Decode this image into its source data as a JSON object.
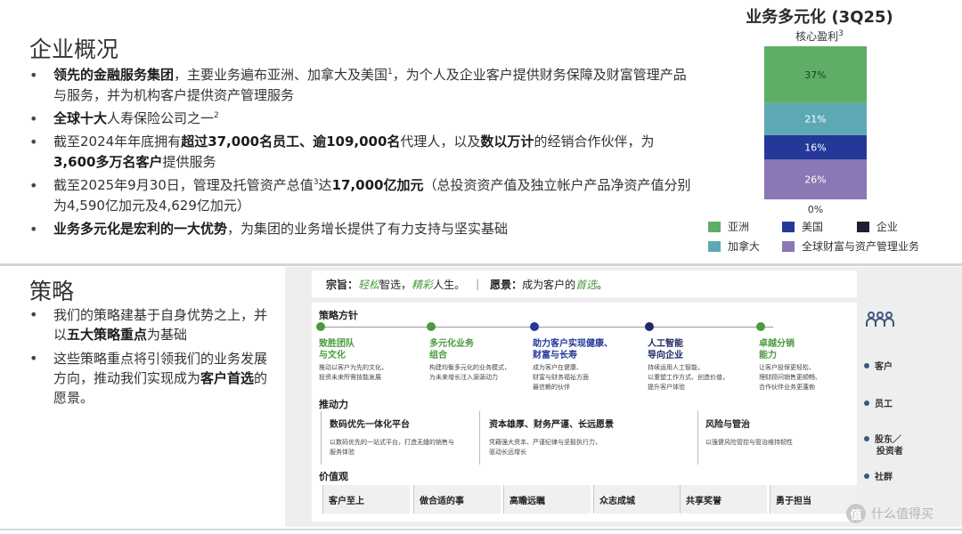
{
  "overview": {
    "title": "企业概况",
    "bullets": [
      [
        {
          "t": "领先的金融服务集团",
          "b": true
        },
        {
          "t": "，主要业务遍布亚洲、加拿大及美国",
          "b": false
        },
        {
          "t": "1",
          "sup": true
        },
        {
          "t": "，为个人及企业客户提供财务保障及财富管理产品与服务，并为机构客户提供资产管理服务",
          "b": false
        }
      ],
      [
        {
          "t": "全球十大",
          "b": true
        },
        {
          "t": "人寿保险公司之一",
          "b": false
        },
        {
          "t": "2",
          "sup": true
        }
      ],
      [
        {
          "t": "截至2024年年底拥有",
          "b": false
        },
        {
          "t": "超过37,000名员工、逾109,000名",
          "b": true
        },
        {
          "t": "代理人，以及",
          "b": false
        },
        {
          "t": "数以万计",
          "b": true
        },
        {
          "t": "的经销合作伙伴，为",
          "b": false
        },
        {
          "t": "3,600多万名客户",
          "b": true
        },
        {
          "t": "提供服务",
          "b": false
        }
      ],
      [
        {
          "t": "截至2025年9月30日，管理及托管资产总值",
          "b": false
        },
        {
          "t": "3",
          "sup": true
        },
        {
          "t": "达",
          "b": false
        },
        {
          "t": "17,000亿加元",
          "b": true
        },
        {
          "t": "（总投资资产值及独立帐户产品净资产值分别为4,590亿加元及4,629亿加元）",
          "b": false
        }
      ],
      [
        {
          "t": "业务多元化是宏利的一大优势",
          "b": true
        },
        {
          "t": "，为集团的业务增长提供了有力支持与坚实基础",
          "b": false
        }
      ]
    ]
  },
  "chart_data": {
    "type": "bar",
    "title": "业务多元化 (3Q25)",
    "subtitle": "核心盈利",
    "subtitle_sup": "3",
    "stacked": true,
    "series": [
      {
        "name": "全球财富与资产管理业务",
        "value": 26,
        "label": "26%",
        "color": "#8a77b3"
      },
      {
        "name": "美国",
        "value": 16,
        "label": "16%",
        "color": "#24389a"
      },
      {
        "name": "加拿大",
        "value": 21,
        "label": "21%",
        "color": "#5ca9b5"
      },
      {
        "name": "亚洲",
        "value": 37,
        "label": "37%",
        "color": "#5fae66"
      },
      {
        "name": "企业",
        "value": 0,
        "label": "0%",
        "color": "#1b1f33"
      }
    ],
    "legend": [
      {
        "name": "亚洲",
        "color": "#5fae66"
      },
      {
        "name": "美国",
        "color": "#24389a"
      },
      {
        "name": "企业",
        "color": "#1b1f33"
      },
      {
        "name": "加拿大",
        "color": "#5ca9b5"
      },
      {
        "name": "全球财富与资产管理业务",
        "color": "#8a77b3"
      }
    ],
    "legend_position": "bottom"
  },
  "strategy": {
    "title": "策略",
    "bullets": [
      [
        {
          "t": "我们的策略建基于自身优势之上，并以",
          "b": false
        },
        {
          "t": "五大策略重点",
          "b": true
        },
        {
          "t": "为基础",
          "b": false
        }
      ],
      [
        {
          "t": "这些策略重点将引领我们的业务发展方向，推动我们实现成为",
          "b": false
        },
        {
          "t": "客户首选",
          "b": true
        },
        {
          "t": "的愿景。",
          "b": false
        }
      ]
    ]
  },
  "framework": {
    "mission_label": "宗旨：",
    "mission_em1": "轻松",
    "mission_mid": "智选，",
    "mission_em2": "精彩",
    "mission_end": "人生。",
    "separator": "|",
    "vision_label": "愿景：",
    "vision_text": "成为客户的",
    "vision_em": "首选",
    "vision_end": "。",
    "plan_heading": "策略方针",
    "plans": [
      {
        "title": "致胜团队\n与文化",
        "desc": "推动以客户为先的文化，\n投资未来所需技能发展",
        "color": "#4a9a3e"
      },
      {
        "title": "多元化业务\n组合",
        "desc": "构建均衡多元化的业务模式，\n为未来增长注入源源动力",
        "color": "#4a9a3e"
      },
      {
        "title": "助力客户实现健康、\n财富与长寿",
        "desc": "成为客户在健康、\n财富与财务福祉方面\n最信赖的伙伴",
        "color": "#24389a"
      },
      {
        "title": "人工智能\n导向企业",
        "desc": "持续运用人工智能，\n以重塑工作方式、创造价值，\n提升客户体验",
        "color": "#1f2a66"
      },
      {
        "title": "卓越分销\n能力",
        "desc": "让客户投保更轻松、\n理财顾问销售更顺畅、\n合作伙伴业务更蓬勃",
        "color": "#4a9a3e"
      }
    ],
    "drivers_heading": "推动力",
    "drivers": [
      {
        "title": "数码优先一体化平台",
        "desc": "以数码优先的一站式平台，打造无缝的销售与\n服务体验"
      },
      {
        "title": "资本雄厚、财务严谨、长远愿景",
        "desc": "凭藉强大资本、严谨纪律与坚毅执行力，\n驱动长远增长"
      },
      {
        "title": "风险与管治",
        "desc": "以强健风险管控与管治维持韧性"
      }
    ],
    "values_heading": "价值观",
    "values": [
      "客户至上",
      "做合适的事",
      "高瞻远瞩",
      "众志成城",
      "共享奖誉",
      "勇于担当"
    ],
    "stakeholders": [
      "客户",
      "员工",
      "股东／\n投资者",
      "社群"
    ]
  },
  "watermark": {
    "text": "什么值得买",
    "logo": "值"
  }
}
